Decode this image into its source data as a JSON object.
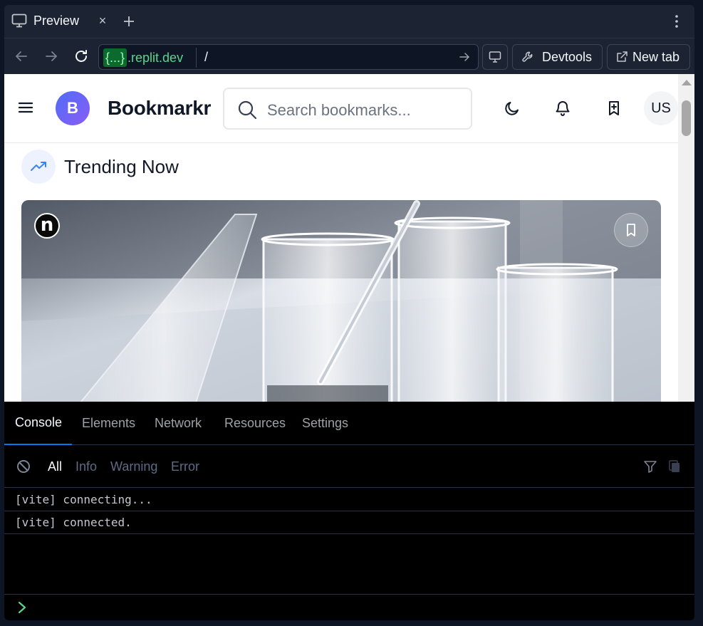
{
  "browser": {
    "tab_label": "Preview",
    "close_glyph": "×",
    "icons": [
      "monitor-icon",
      "close-icon",
      "plus-icon",
      "kebab-icon",
      "back-icon",
      "forward-icon",
      "reload-icon",
      "go-icon",
      "wrench-icon",
      "external-link-icon"
    ],
    "url_host_braces": "{...}",
    "url_host_domain": ".replit.dev",
    "url_path": "/",
    "devtools_label": "Devtools",
    "newtab_label": "New tab",
    "accent_green": "#58d68d"
  },
  "app": {
    "logo_letter": "B",
    "brand": "Bookmarkr",
    "search_placeholder": "Search bookmarks...",
    "avatar": "US",
    "header_icons": [
      "menu-icon",
      "search-icon",
      "moon-icon",
      "bell-icon",
      "bookmark-plus-icon"
    ],
    "section_title": "Trending Now",
    "section_icon": "trending-up-icon",
    "card": {
      "source_badge": "n",
      "bookmark_icon": "bookmark-icon"
    },
    "logo_gradient": [
      "#4f6df5",
      "#8b5cf6"
    ]
  },
  "devtools": {
    "tabs": [
      "Console",
      "Elements",
      "Network",
      "Resources",
      "Settings"
    ],
    "active_tab": "Console",
    "levels": [
      "All",
      "Info",
      "Warning",
      "Error"
    ],
    "selected_level": "All",
    "logs": [
      "[vite] connecting...",
      "[vite] connected."
    ],
    "tab_accent": "#0079f2",
    "prompt_color": "#58d68d"
  }
}
